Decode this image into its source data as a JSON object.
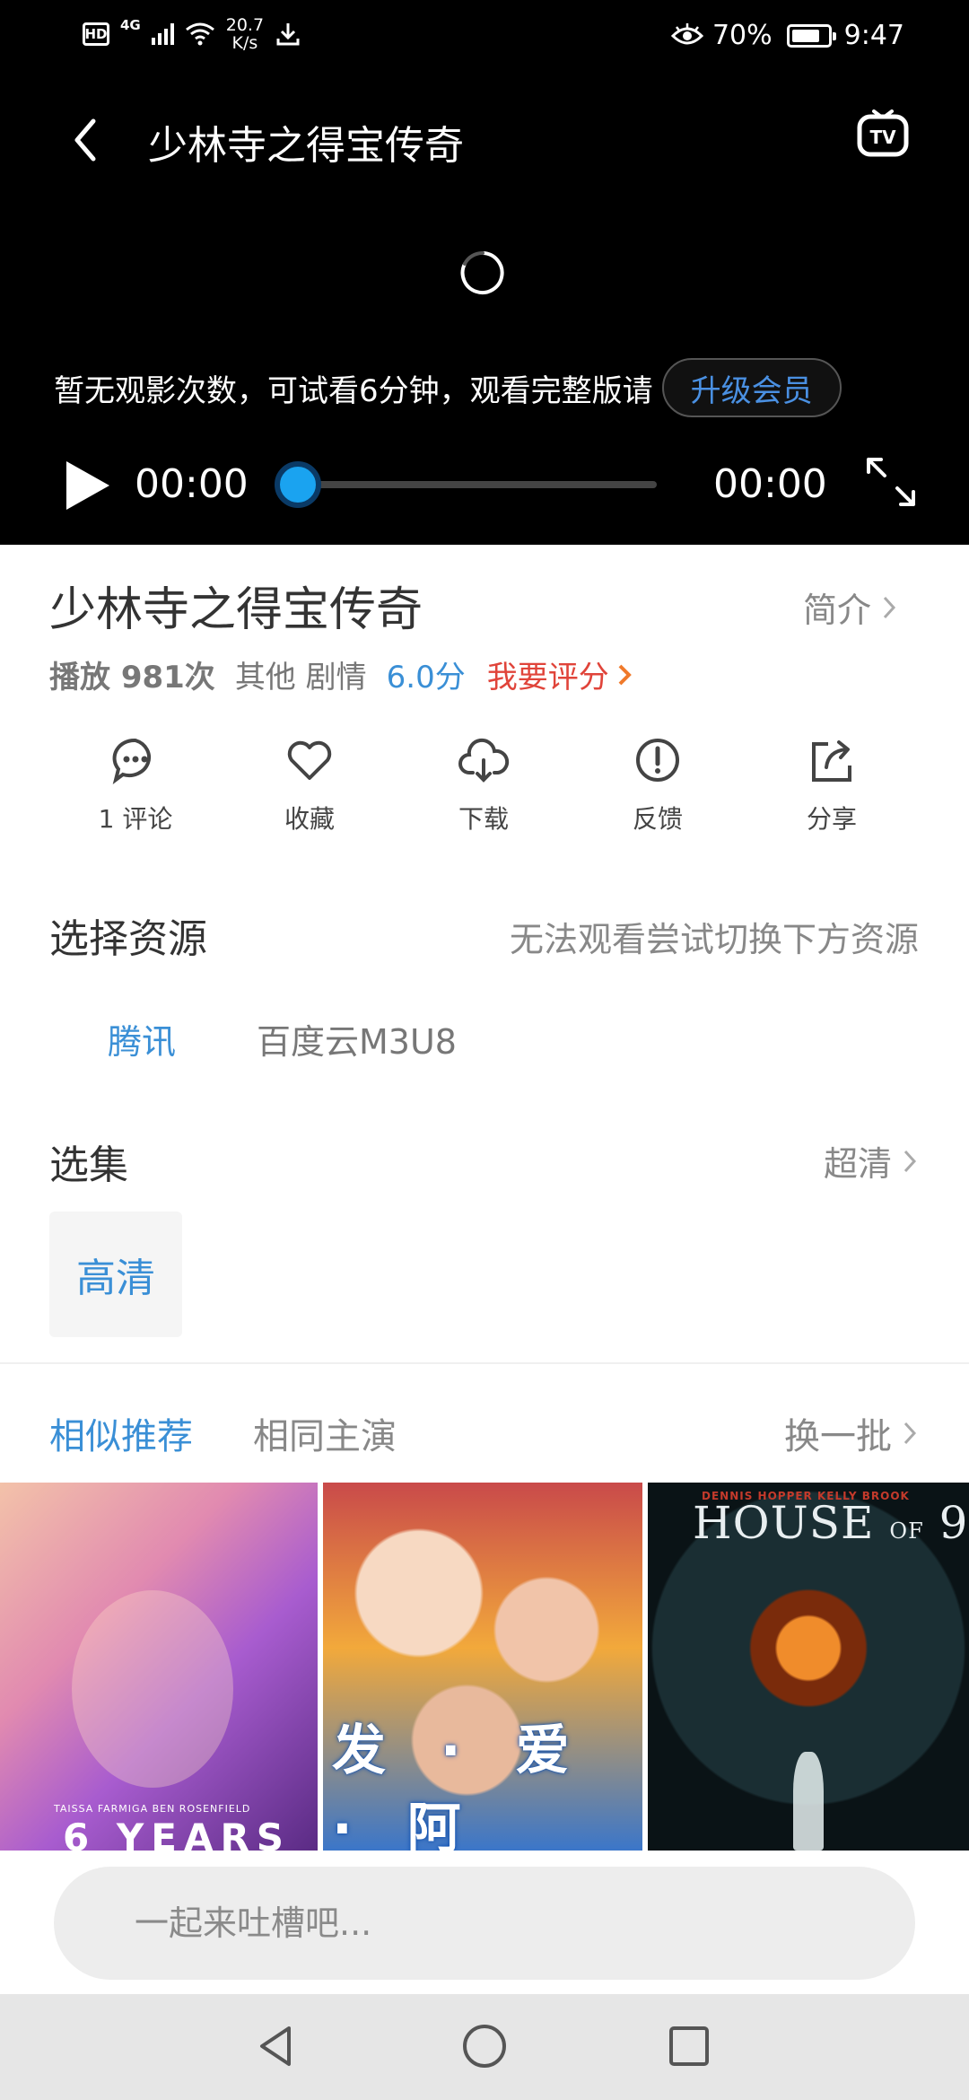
{
  "status_bar": {
    "hd": "HD",
    "network": "4G",
    "speed_value": "20.7",
    "speed_unit": "K/s",
    "battery": "70%",
    "time": "9:47"
  },
  "player": {
    "title": "少林寺之得宝传奇",
    "trial_text": "暂无观影次数，可试看6分钟，观看完整版请",
    "upgrade_label": "升级会员",
    "time_current": "00:00",
    "time_total": "00:00",
    "progress": 0
  },
  "info": {
    "title": "少林寺之得宝传奇",
    "intro_label": "简介",
    "plays": "播放 981次",
    "genre": "其他 剧情",
    "score": "6.0分",
    "rate_label": "我要评分"
  },
  "actions": [
    {
      "icon": "comment-icon",
      "label": "1 评论"
    },
    {
      "icon": "heart-icon",
      "label": "收藏"
    },
    {
      "icon": "cloud-download-icon",
      "label": "下载"
    },
    {
      "icon": "feedback-icon",
      "label": "反馈"
    },
    {
      "icon": "share-icon",
      "label": "分享"
    }
  ],
  "source_section": {
    "title": "选择资源",
    "hint": "无法观看尝试切换下方资源",
    "sources": [
      "腾讯",
      "百度云M3U8"
    ]
  },
  "episode_section": {
    "title": "选集",
    "quality": "超清",
    "episode": "高清"
  },
  "recommend": {
    "tabs": [
      "相似推荐",
      "相同主演"
    ],
    "refresh_label": "换一批",
    "posters": [
      {
        "caption": "TAISSA FARMIGA   BEN ROSENFIELD",
        "big_text": "6 YEARS"
      },
      {
        "title": "发 · 爱 · 阿"
      },
      {
        "credits": "DENNIS HOPPER   KELLY BROOK",
        "title_main": "HOUSE",
        "title_small": "OF",
        "title_num": "9"
      }
    ]
  },
  "comment": {
    "placeholder": "一起来吐槽吧..."
  },
  "colors": {
    "accent": "#3a8fd6",
    "rate": "#e0443a",
    "knob": "#1aa3f0"
  }
}
